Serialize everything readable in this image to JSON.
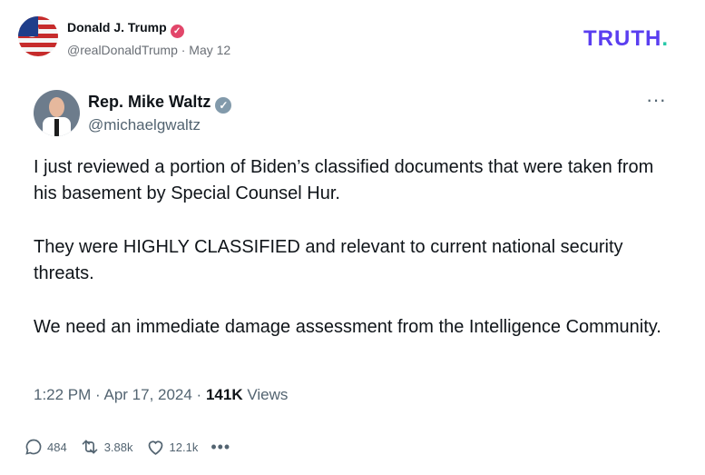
{
  "outer": {
    "name": "Donald J. Trump",
    "verified_badge": "✓",
    "handle": "@realDonaldTrump",
    "date": "May 12",
    "handle_line": "@realDonaldTrump · May 12"
  },
  "logo": {
    "text": "TRUTH",
    "dot": "."
  },
  "inner": {
    "name": "Rep. Mike Waltz",
    "verified_badge": "✓",
    "handle": "@michaelgwaltz",
    "more": "···",
    "paragraphs": [
      "I just reviewed a portion of Biden’s classified documents that were taken from his basement by Special Counsel Hur.",
      "They were HIGHLY CLASSIFIED and relevant to current national security threats.",
      "We need an immediate damage assessment from the Intelligence Community."
    ],
    "time": "1:22 PM · Apr 17, 2024 · ",
    "views_count": "141K",
    "views_label": " Views"
  },
  "actions": {
    "replies": "484",
    "retruths": "3.88k",
    "likes": "12.1k",
    "more": "•••"
  },
  "colors": {
    "logo": "#5a3ef0",
    "logo_dot": "#27c9a8",
    "verified_red": "#e2466a",
    "verified_grey": "#829aab"
  },
  "icons": [
    "reply-icon",
    "retruth-icon",
    "like-icon",
    "more-icon"
  ]
}
